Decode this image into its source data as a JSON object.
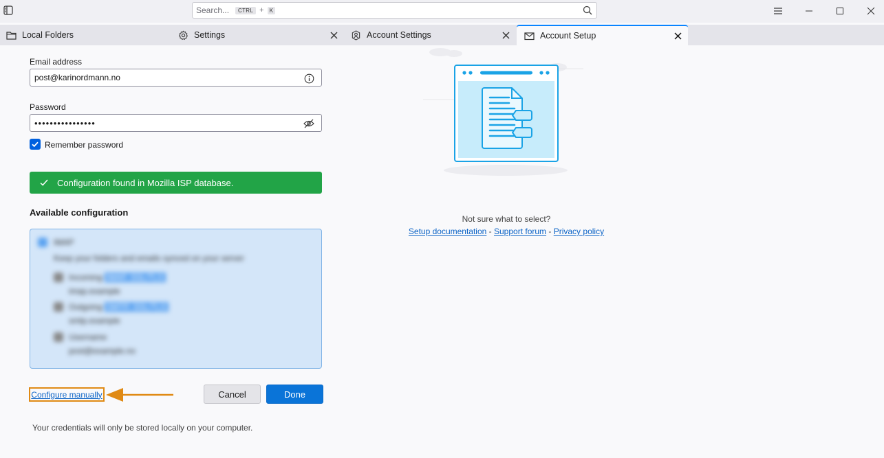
{
  "titlebar": {
    "search": {
      "placeholder": "Search...",
      "shortcut_mod": "CTRL",
      "shortcut_plus": "+",
      "shortcut_key": "K"
    }
  },
  "tabs": [
    {
      "label": "Local Folders",
      "icon": "folder-icon"
    },
    {
      "label": "Settings",
      "icon": "gear-icon"
    },
    {
      "label": "Account Settings",
      "icon": "account-gear-icon"
    },
    {
      "label": "Account Setup",
      "icon": "envelope-icon",
      "active": true
    }
  ],
  "form": {
    "email_label": "Email address",
    "email_value": "post@karinordmann.no",
    "password_label": "Password",
    "password_value": "••••••••••••••••",
    "remember_label": "Remember password",
    "remember_checked": true
  },
  "notice": {
    "text": "Configuration found in Mozilla ISP database.",
    "color": "#22a447"
  },
  "config": {
    "heading": "Available configuration",
    "blurred_rows": [
      "IMAP",
      "Keep your folders and emails synced on your server",
      "Incoming",
      "imap.example",
      "Outgoing",
      "smtp.example",
      "Username",
      "post@example.no"
    ],
    "blurred_highlights": [
      "IMAP, SSL/TLS",
      "SMTP, SSL/TLS"
    ]
  },
  "actions": {
    "configure_manually": "Configure manually",
    "cancel": "Cancel",
    "done": "Done",
    "accent": "#0a74d8",
    "highlight_color": "#e08a14"
  },
  "footer": {
    "text": "Your credentials will only be stored locally on your computer."
  },
  "help": {
    "question": "Not sure what to select?",
    "setup_doc": "Setup documentation",
    "sep1": " - ",
    "support_forum": "Support forum",
    "sep2": " - ",
    "privacy_policy": "Privacy policy"
  }
}
